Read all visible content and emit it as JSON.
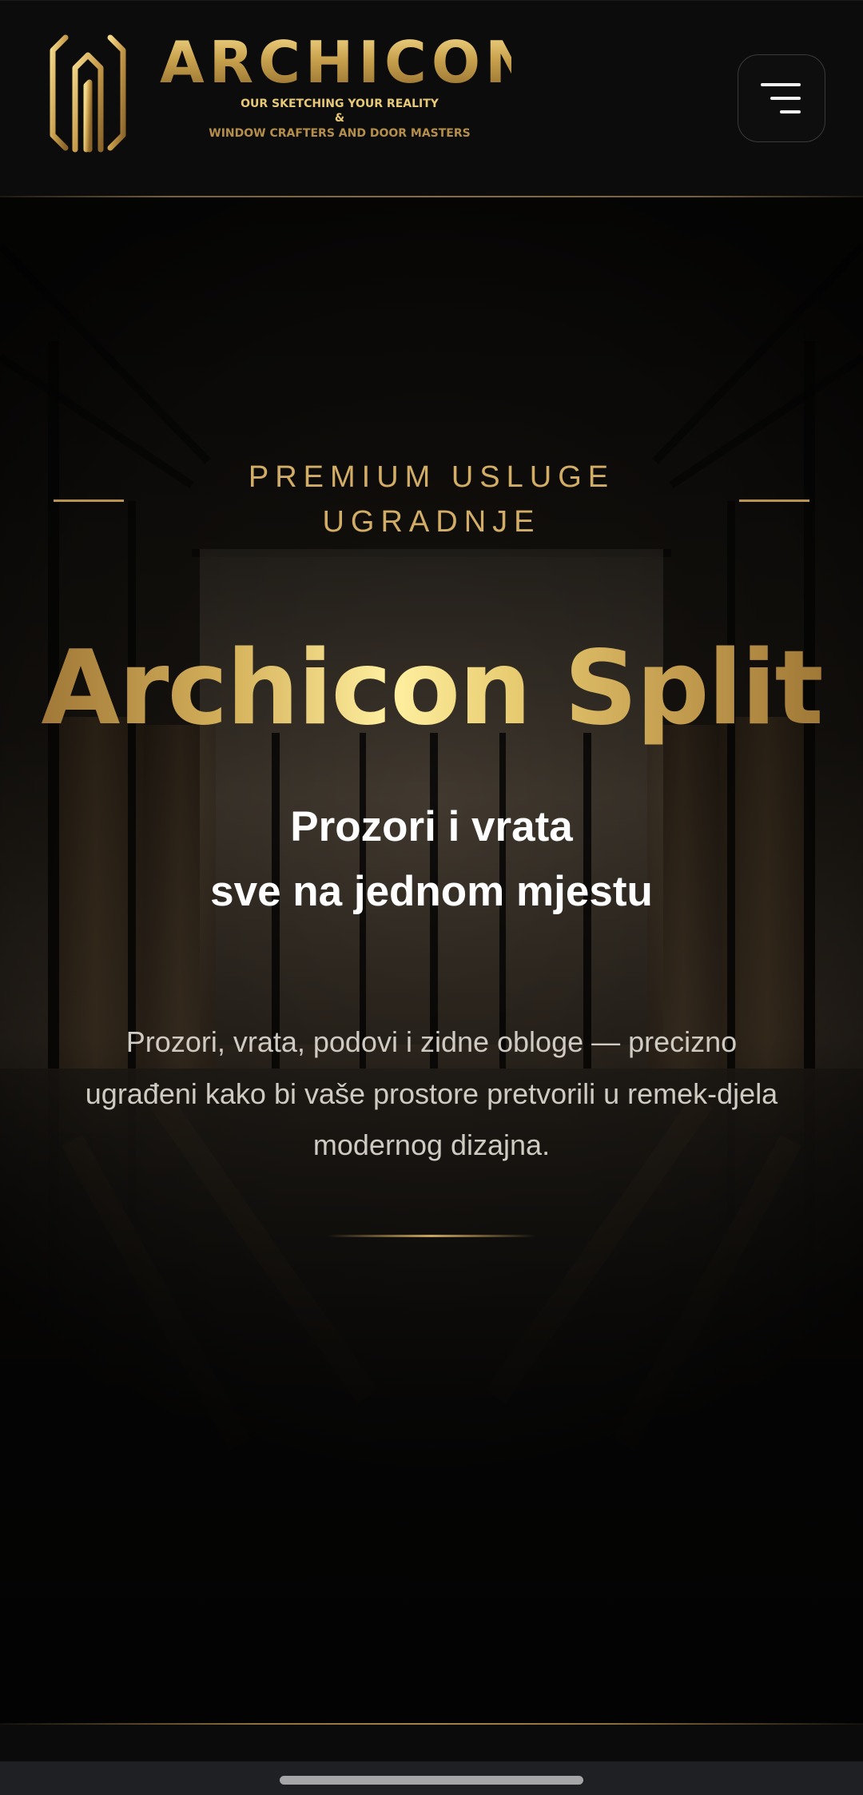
{
  "header": {
    "brand_name": "ARCHICON",
    "tagline_line1": "OUR SKETCHING YOUR REALITY",
    "tagline_line2": "&",
    "tagline_line3": "WINDOW CRAFTERS AND DOOR MASTERS",
    "logo_icon": "archicon-logo-icon",
    "menu_icon": "hamburger-menu-icon"
  },
  "hero": {
    "eyebrow": "PREMIUM USLUGE UGRADNJE",
    "title": "Archicon Split",
    "subtitle_line1": "Prozori i vrata",
    "subtitle_line2": "sve na jednom mjestu",
    "description_line1": "Prozori, vrata, podovi i zidne obloge — precizno",
    "description_line2": "ugrađeni kako bi vaše prostore pretvorili u remek-djela",
    "description_line3": "modernog dizajna."
  },
  "theme": {
    "background": "#0b0b0b",
    "gold_accent": "#d2ad66",
    "gold_light": "#f6dc8c",
    "gold_dark": "#8e6a2c",
    "text_primary": "#ffffff",
    "text_secondary": "#cfcac2",
    "system_bar": "#1f2024"
  }
}
